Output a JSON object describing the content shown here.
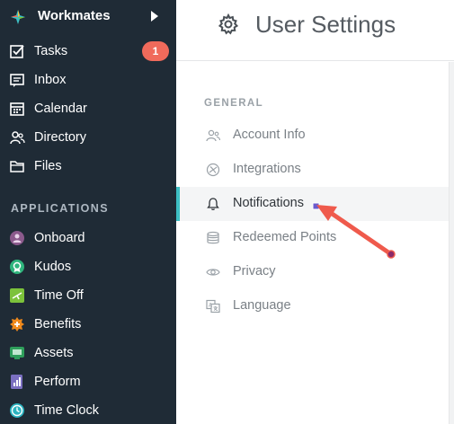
{
  "sidebar": {
    "brand": "Workmates",
    "main_items": [
      {
        "label": "Tasks",
        "icon": "checkbox-icon",
        "badge": "1"
      },
      {
        "label": "Inbox",
        "icon": "inbox-icon"
      },
      {
        "label": "Calendar",
        "icon": "calendar-icon"
      },
      {
        "label": "Directory",
        "icon": "people-icon"
      },
      {
        "label": "Files",
        "icon": "folder-icon"
      }
    ],
    "section_title": "APPLICATIONS",
    "app_items": [
      {
        "label": "Onboard",
        "icon": "onboard-icon",
        "color": "#8b5a8c"
      },
      {
        "label": "Kudos",
        "icon": "kudos-icon",
        "color": "#2fb57d"
      },
      {
        "label": "Time Off",
        "icon": "time-off-icon",
        "color": "#7cc23b"
      },
      {
        "label": "Benefits",
        "icon": "benefits-icon",
        "color": "#f08a1c"
      },
      {
        "label": "Assets",
        "icon": "assets-icon",
        "color": "#2e9e5b"
      },
      {
        "label": "Perform",
        "icon": "perform-icon",
        "color": "#7a6fc0"
      },
      {
        "label": "Time Clock",
        "icon": "time-clock-icon",
        "color": "#2bb3c0"
      }
    ]
  },
  "header": {
    "title": "User Settings",
    "icon": "gear-icon"
  },
  "settings": {
    "group_title": "GENERAL",
    "items": [
      {
        "label": "Account Info",
        "icon": "account-icon"
      },
      {
        "label": "Integrations",
        "icon": "integrations-icon"
      },
      {
        "label": "Notifications",
        "icon": "bell-icon",
        "active": true
      },
      {
        "label": "Redeemed Points",
        "icon": "coins-icon"
      },
      {
        "label": "Privacy",
        "icon": "eye-icon"
      },
      {
        "label": "Language",
        "icon": "language-icon"
      }
    ]
  },
  "colors": {
    "sidebar_bg": "#1f2b36",
    "accent": "#3dbfc4",
    "badge": "#f06a5b",
    "annotation_arrow": "#ef5a4c"
  }
}
